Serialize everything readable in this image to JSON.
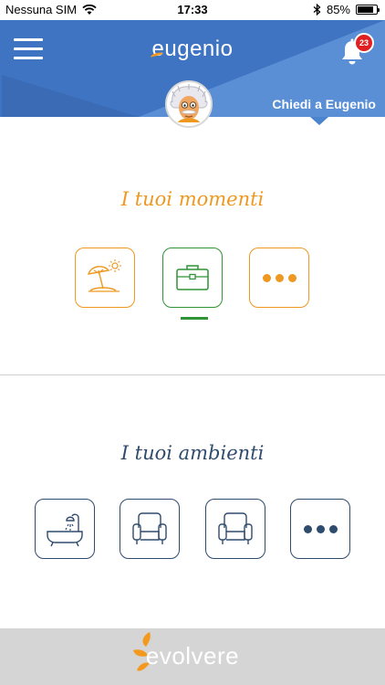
{
  "status": {
    "carrier": "Nessuna SIM",
    "time": "17:33",
    "battery_label": "85%",
    "battery_level": 0.85
  },
  "header": {
    "logo": "eugenio",
    "notification_count": "23",
    "ask_label": "Chiedi a Eugenio",
    "colors": {
      "primary": "#3f74c2",
      "accent": "#f39a1e"
    }
  },
  "moments": {
    "title": "I tuoi momenti",
    "tiles": [
      {
        "icon": "beach-umbrella-icon",
        "color": "#ee9820",
        "active": false
      },
      {
        "icon": "briefcase-icon",
        "color": "#2f9436",
        "active": true
      },
      {
        "icon": "more-dots-icon",
        "color": "#ee9820",
        "active": false
      }
    ]
  },
  "environments": {
    "title": "I tuoi ambienti",
    "tiles": [
      {
        "icon": "bathtub-icon",
        "color": "#2f4b6e"
      },
      {
        "icon": "armchair-icon",
        "color": "#2f4b6e"
      },
      {
        "icon": "armchair-icon",
        "color": "#2f4b6e"
      },
      {
        "icon": "more-dots-icon",
        "color": "#2f4b6e"
      }
    ]
  },
  "footer": {
    "brand": "evolvere"
  }
}
